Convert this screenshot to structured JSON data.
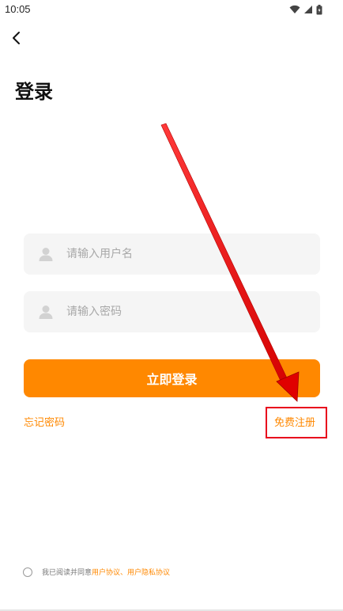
{
  "status_bar": {
    "time": "10:05",
    "icons": [
      "wifi-icon",
      "signal-icon",
      "battery-icon"
    ]
  },
  "header": {
    "back_icon": "chevron-left-icon",
    "title": "登录"
  },
  "form": {
    "username": {
      "placeholder": "请输入用户名",
      "value": "",
      "icon": "user-icon"
    },
    "password": {
      "placeholder": "请输入密码",
      "value": "",
      "icon": "user-icon"
    },
    "login_label": "立即登录",
    "forgot_label": "忘记密码",
    "register_label": "免费注册"
  },
  "agreement": {
    "prefix": "我已阅读并同意",
    "user_agreement": "用户协议",
    "separator": "、",
    "privacy_agreement": "用户隐私协议"
  },
  "colors": {
    "accent": "#ff8800",
    "annotation": "#e8001c",
    "field_bg": "#f5f5f5"
  }
}
